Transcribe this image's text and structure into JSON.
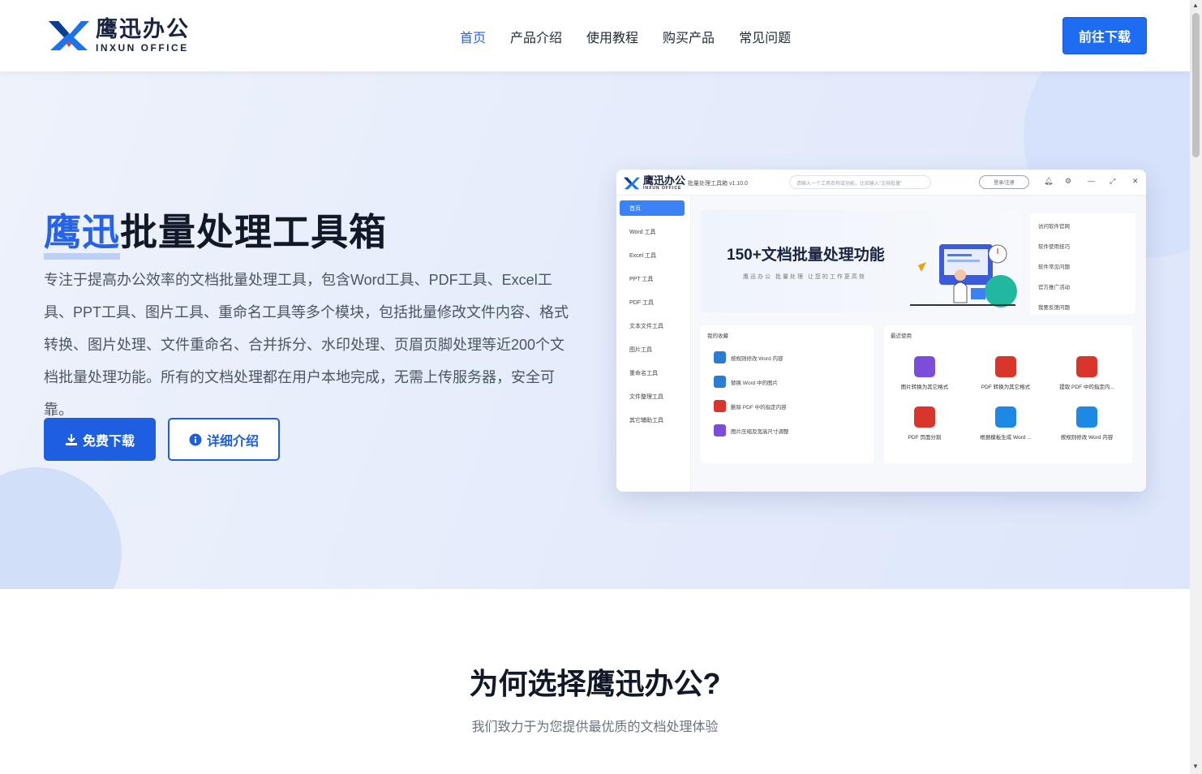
{
  "header": {
    "logo_cn": "鹰迅办公",
    "logo_en": "INXUN OFFICE",
    "nav": [
      "首页",
      "产品介绍",
      "使用教程",
      "购买产品",
      "常见问题"
    ],
    "cta": "前往下载"
  },
  "hero": {
    "title_brand": "鹰迅",
    "title_rest": "批量处理工具箱",
    "description": "专注于提高办公效率的文档批量处理工具，包含Word工具、PDF工具、Excel工具、PPT工具、图片工具、重命名工具等多个模块，包括批量修改文件内容、格式转换、图片处理、文件重命名、合并拆分、水印处理、页眉页脚处理等近200个文档批量处理功能。所有的文档处理都在用户本地完成，无需上传服务器，安全可靠。",
    "primary_button": "免费下载",
    "secondary_button": "详细介绍"
  },
  "mockup": {
    "logo_cn": "鹰迅办公",
    "logo_en": "INXUN OFFICE",
    "app_name": "批量处理工具箱 v1.10.0",
    "search_placeholder": "请输入一个工具名称或功能，比如输入\"文档批量\"",
    "login": "登录/注册",
    "sidebar": [
      "首页",
      "Word 工具",
      "Excel 工具",
      "PPT 工具",
      "PDF 工具",
      "文本文件工具",
      "图片工具",
      "重命名工具",
      "文件整理工具",
      "其它辅助工具"
    ],
    "banner_title": "150+文档批量处理功能",
    "banner_sub": "鹰迅办公 批量处理 让您的工作更高效",
    "links": [
      "访问软件官网",
      "软件使用技巧",
      "软件常见问题",
      "官方推广活动",
      "我要反馈问题"
    ],
    "favorites_title": "我的收藏",
    "favorites": [
      "按规则修改 Word 内容",
      "替换 Word 中的图片",
      "删除 PDF 中的指定内容",
      "图片压缩及宽高尺寸调整"
    ],
    "recent_title": "最近使用",
    "recent": [
      "图片转换为其它格式",
      "PDF 转换为其它格式",
      "提取 PDF 中的指定内...",
      "PDF 页面分割",
      "根据模板生成 Word ...",
      "按规则修改 Word 内容"
    ]
  },
  "why": {
    "title": "为何选择鹰迅办公?",
    "subtitle": "我们致力于为您提供最优质的文档处理体验"
  },
  "colors": {
    "accent": "#1d5fe0",
    "nav_active": "#2563eb",
    "hero_bg": "#e5ecfb"
  }
}
